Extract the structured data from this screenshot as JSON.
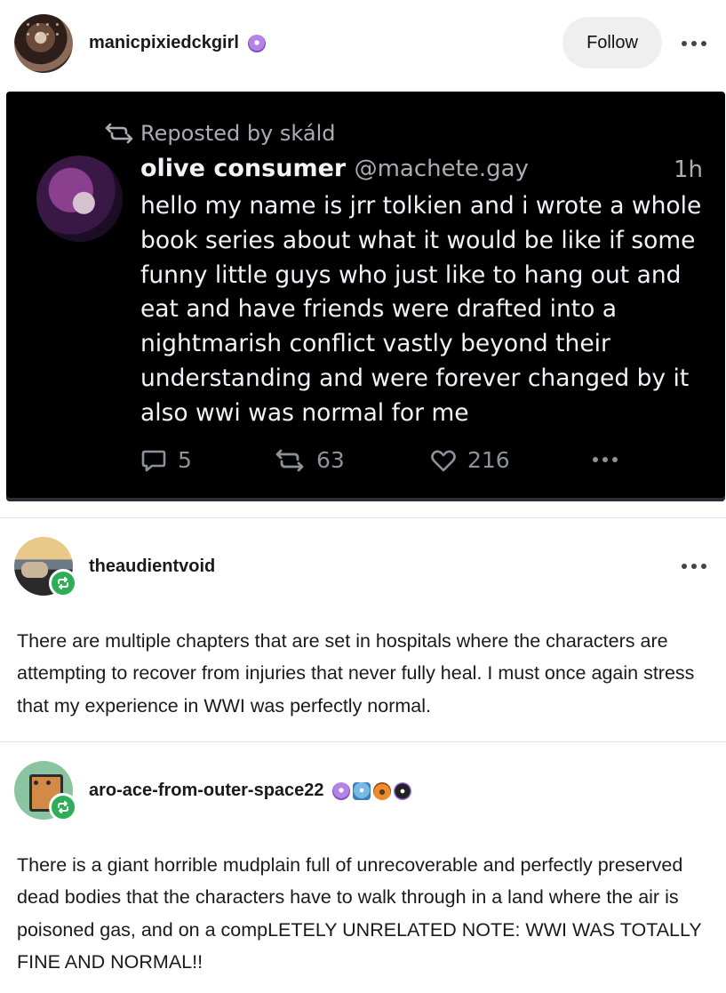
{
  "original_post": {
    "author": "manicpixiedckgirl",
    "follow_label": "Follow",
    "embed": {
      "repost_label": "Reposted by skáld",
      "display_name": "olive consumer",
      "handle": "@machete.gay",
      "time": "1h",
      "body": "hello my name is jrr tolkien and i wrote a whole book series about what it would be like if some funny little guys who just like to hang out and eat and have friends were drafted into a nightmarish conflict vastly beyond their understanding and were forever changed by it also wwi was normal for me",
      "replies": "5",
      "reposts": "63",
      "likes": "216"
    }
  },
  "reblogs": [
    {
      "author": "theaudientvoid",
      "text": "There are multiple chapters that are set in hospitals where the characters are attempting to recover from injuries that never fully heal. I must once again stress that my experience in WWI was perfectly normal."
    },
    {
      "author": "aro-ace-from-outer-space22",
      "text": "There is a giant horrible mudplain full of unrecoverable and perfectly preserved dead bodies that the characters have to walk through in a land where the air is poisoned gas, and on a compLETELY UNRELATED NOTE: WWI WAS TOTALLY FINE AND NORMAL!!"
    }
  ]
}
